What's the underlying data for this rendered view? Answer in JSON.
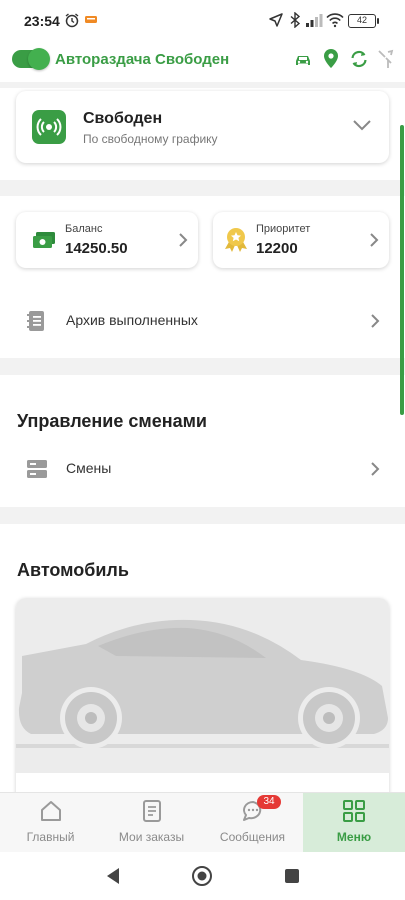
{
  "statusbar": {
    "time": "23:54",
    "battery": "42",
    "icons": [
      "alarm-icon",
      "notification-icon",
      "location-arrow-icon",
      "bluetooth-icon",
      "signal-icon",
      "wifi-icon",
      "battery-icon"
    ]
  },
  "topbar": {
    "title": "Автораздача Свободен",
    "toggle_on": true,
    "icons": [
      "car-icon",
      "location-pin-icon",
      "refresh-icon",
      "signal-off-icon"
    ],
    "accent": "#3a9d45"
  },
  "status_card": {
    "icon": "broadcast-icon",
    "title": "Свободен",
    "subtitle": "По свободному графику"
  },
  "balance": {
    "icon": "money-icon",
    "label": "Баланс",
    "value": "14250.50"
  },
  "priority": {
    "icon": "medal-icon",
    "label": "Приоритет",
    "value": "12200"
  },
  "archive": {
    "icon": "document-icon",
    "label": "Архив выполненных"
  },
  "shifts_section": {
    "title": "Управление сменами",
    "row": {
      "icon": "shifts-icon",
      "label": "Смены"
    }
  },
  "car_section": {
    "title": "Автомобиль",
    "image": "car-silhouette-placeholder"
  },
  "bottom_nav": {
    "items": [
      {
        "icon": "home-icon",
        "label": "Главный",
        "active": false
      },
      {
        "icon": "orders-icon",
        "label": "Мои заказы",
        "active": false
      },
      {
        "icon": "chat-icon",
        "label": "Сообщения",
        "active": false,
        "badge": "34"
      },
      {
        "icon": "grid-icon",
        "label": "Меню",
        "active": true
      }
    ],
    "active_color": "#3a9d45",
    "badge_color": "#e53935"
  }
}
